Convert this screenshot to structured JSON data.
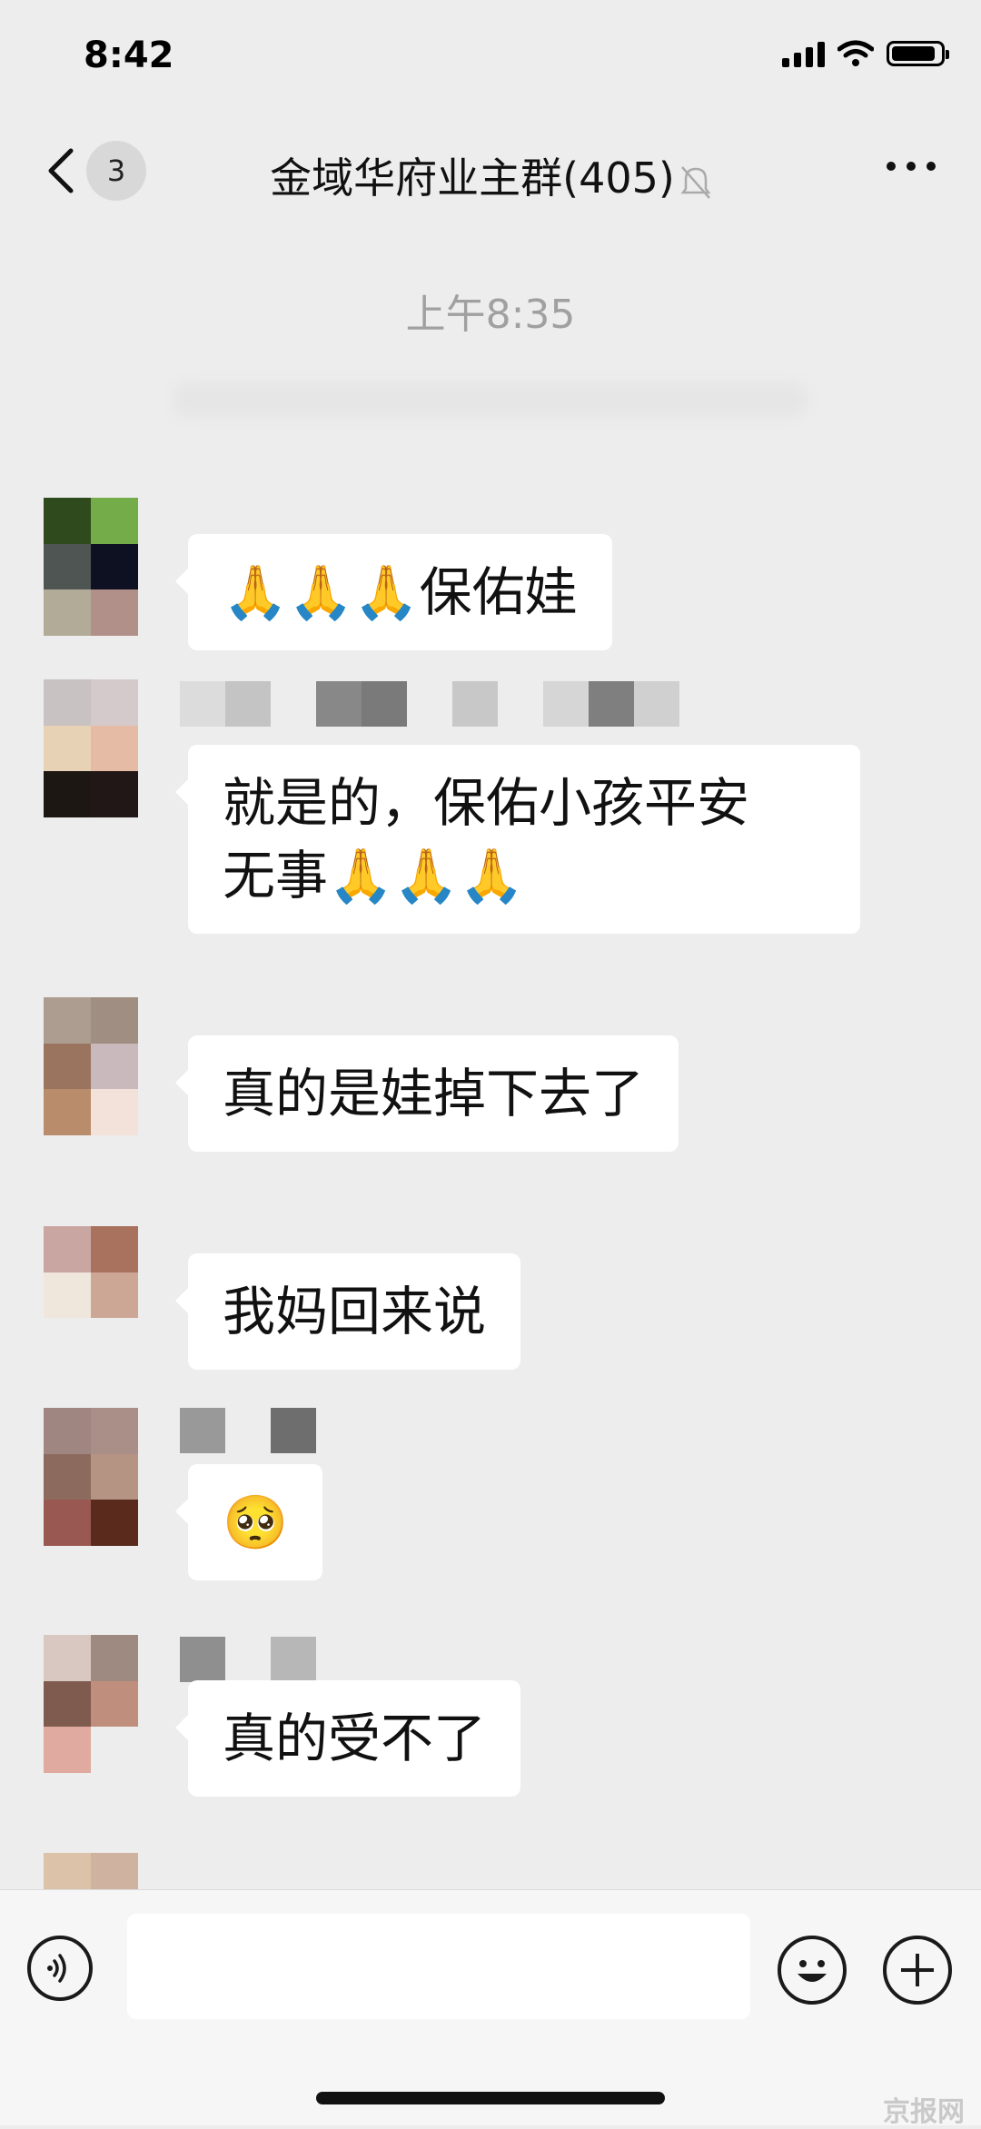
{
  "status_bar": {
    "time": "8:42",
    "battery_level": 0.9
  },
  "nav": {
    "unread_count": "3",
    "title": "金域华府业主群(405)"
  },
  "time_divider": "上午8:35",
  "messages": [
    {
      "text": "🙏🙏🙏保佑娃"
    },
    {
      "line1": "就是的，保佑小孩平安",
      "line2": "无事🙏🙏🙏"
    },
    {
      "text": "真的是娃掉下去了"
    },
    {
      "text": "我妈回来说"
    },
    {
      "text": "🥺"
    },
    {
      "text": "真的受不了"
    }
  ],
  "input": {
    "placeholder": ""
  },
  "colors": {
    "background": "#ededed",
    "bubble": "#ffffff",
    "time_text": "#a0a0a0"
  },
  "icons": [
    "back-icon",
    "mute-icon",
    "more-icon",
    "voice-icon",
    "emoji-icon",
    "plus-icon"
  ],
  "watermark": "京报网"
}
